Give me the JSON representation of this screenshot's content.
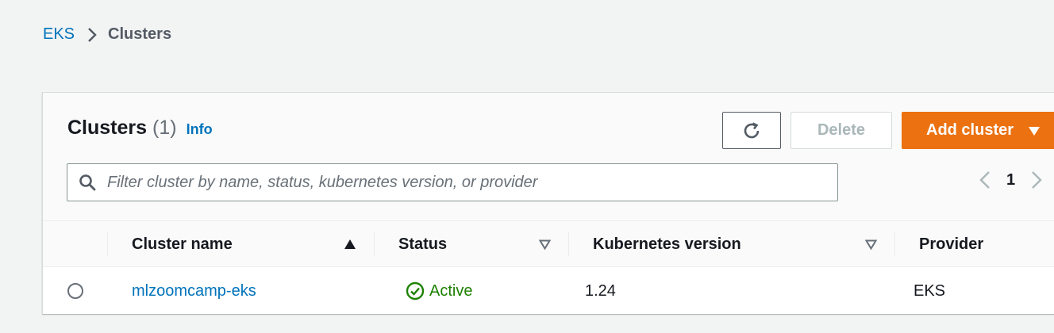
{
  "breadcrumb": {
    "root": "EKS",
    "current": "Clusters"
  },
  "panel": {
    "title": "Clusters",
    "count": "(1)",
    "info": "Info"
  },
  "actions": {
    "refresh_icon": "refresh-icon",
    "delete_label": "Delete",
    "add_label": "Add cluster"
  },
  "search": {
    "placeholder": "Filter cluster by name, status, kubernetes version, or provider",
    "value": ""
  },
  "pagination": {
    "current_page": "1"
  },
  "table": {
    "columns": [
      "Cluster name",
      "Status",
      "Kubernetes version",
      "Provider"
    ],
    "rows": [
      {
        "name": "mlzoomcamp-eks",
        "status": "Active",
        "version": "1.24",
        "provider": "EKS"
      }
    ]
  },
  "colors": {
    "accent": "#ec7211",
    "link": "#0073bb",
    "success": "#1d8102"
  }
}
